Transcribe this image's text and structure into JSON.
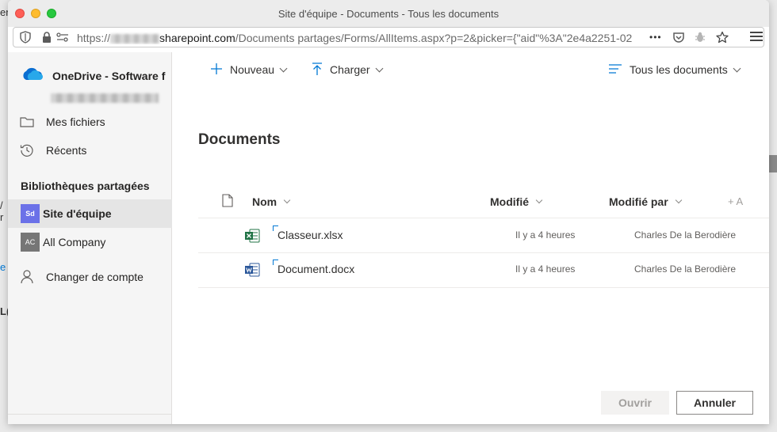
{
  "window": {
    "title": "Site d'équipe - Documents - Tous les documents"
  },
  "browser": {
    "url_prefix": "https://",
    "url_host": "sharepoint.com",
    "url_path": "/Documents partages/Forms/AllItems.aspx?p=2&picker={\"aid\"%3A\"2e4a2251-02",
    "more": "•••"
  },
  "background": {
    "frag_left_top": "en",
    "frag_left_mid": "/ r",
    "frag_left_low": "e",
    "frag_left_bottom": "L("
  },
  "sidebar": {
    "brand": "OneDrive - Software f",
    "items": [
      {
        "label": "Mes fichiers",
        "icon": "folder-icon"
      },
      {
        "label": "Récents",
        "icon": "history-icon"
      }
    ],
    "section_title": "Bibliothèques partagées",
    "libraries": [
      {
        "label": "Site d'équipe",
        "badge": "Sd",
        "color": "#6b71e8",
        "selected": true
      },
      {
        "label": "All Company",
        "badge": "AC",
        "color": "#767676",
        "selected": false
      }
    ],
    "switch_account": "Changer de compte"
  },
  "commands": {
    "new": "Nouveau",
    "upload": "Charger",
    "view": "Tous les documents"
  },
  "main": {
    "title": "Documents"
  },
  "list": {
    "columns": {
      "name": "Nom",
      "modified": "Modifié",
      "modified_by": "Modifié par",
      "add": "+ A"
    },
    "rows": [
      {
        "name": "Classeur.xlsx",
        "type": "excel",
        "modified": "Il y a 4 heures",
        "modified_by": "Charles De la Berodière"
      },
      {
        "name": "Document.docx",
        "type": "word",
        "modified": "Il y a 4 heures",
        "modified_by": "Charles De la Berodière"
      }
    ]
  },
  "footer": {
    "open": "Ouvrir",
    "cancel": "Annuler"
  },
  "colors": {
    "accent": "#0078d4",
    "excel": "#217346",
    "word": "#2b579a"
  }
}
